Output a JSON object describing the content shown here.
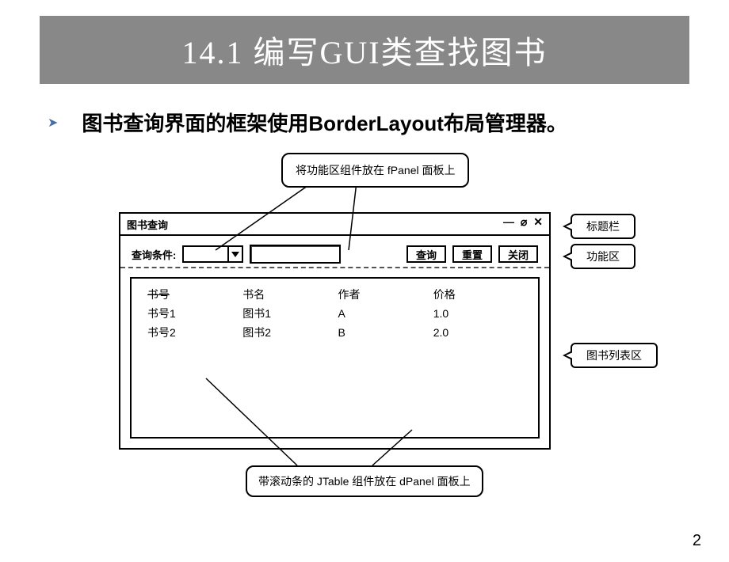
{
  "slide": {
    "title": "14.1 编写GUI类查找图书",
    "bullet": "图书查询界面的框架使用BorderLayout布局管理器。",
    "page_number": "2"
  },
  "callouts": {
    "top": "将功能区组件放在 fPanel 面板上",
    "bottom": "带滚动条的 JTable 组件放在 dPanel 面板上"
  },
  "side_labels": {
    "titlebar": "标题栏",
    "function": "功能区",
    "list": "图书列表区"
  },
  "window": {
    "title": "图书查询",
    "controls_glyph": "— ⌀ ✕",
    "query_label": "查询条件:",
    "buttons": {
      "query": "查询",
      "reset": "重置",
      "close": "关闭"
    }
  },
  "table": {
    "headers": [
      "书号",
      "书名",
      "作者",
      "价格"
    ],
    "rows": [
      [
        "书号1",
        "图书1",
        "A",
        "1.0"
      ],
      [
        "书号2",
        "图书2",
        "B",
        "2.0"
      ]
    ]
  }
}
